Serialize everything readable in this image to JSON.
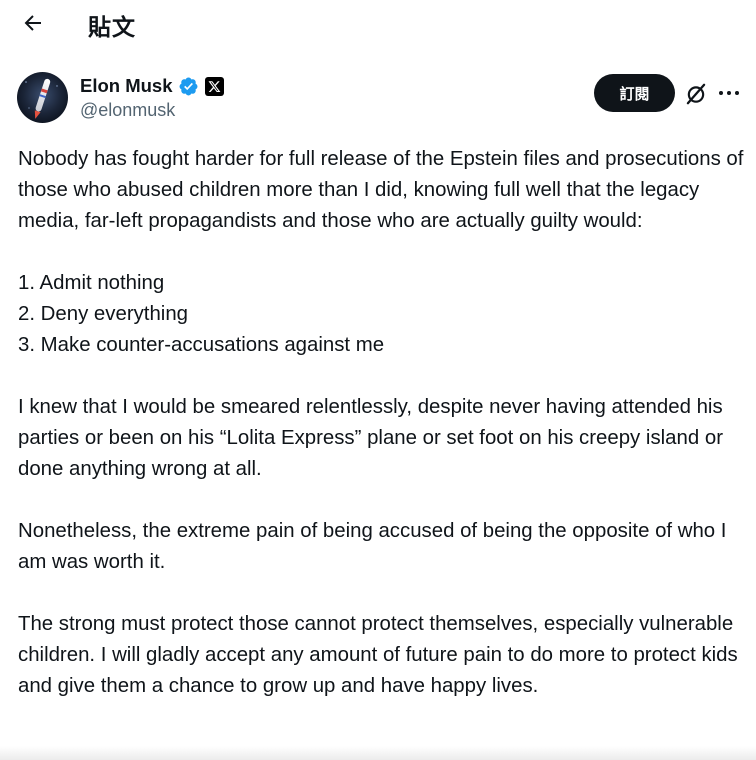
{
  "header": {
    "title": "貼文",
    "back_icon": "arrow-left-icon"
  },
  "author": {
    "display_name": "Elon Musk",
    "handle": "@elonmusk",
    "verified_icon": "verified-badge-icon",
    "affiliate_icon": "x-logo-icon",
    "avatar_icon": "avatar",
    "subscribe_label": "訂閱",
    "grok_icon": "grok-icon",
    "more_icon": "more-horizontal-icon",
    "colors": {
      "verified": "#1d9bf0",
      "subscribe_bg": "#0f1419",
      "handle": "#536471"
    }
  },
  "tweet": {
    "paragraph1": "Nobody has fought harder for full release of the Epstein files and prosecutions of those who abused children more than I did, knowing full well that the legacy media, far-left propagandists and those who are actually guilty would:",
    "list": [
      "1. Admit nothing",
      "2. Deny everything",
      "3. Make counter-accusations against me"
    ],
    "paragraph2": "I knew that I would be smeared relentlessly, despite never having attended his parties or been on his “Lolita Express” plane or set foot on his creepy island or done anything wrong at all.",
    "paragraph3": "Nonetheless, the extreme pain of being accused of being the opposite of who I am was worth it.",
    "paragraph4": "The strong must protect those cannot protect themselves, especially vulnerable children. I will gladly accept any amount of future pain to do more to protect kids and give them a chance to grow up and have happy lives."
  }
}
